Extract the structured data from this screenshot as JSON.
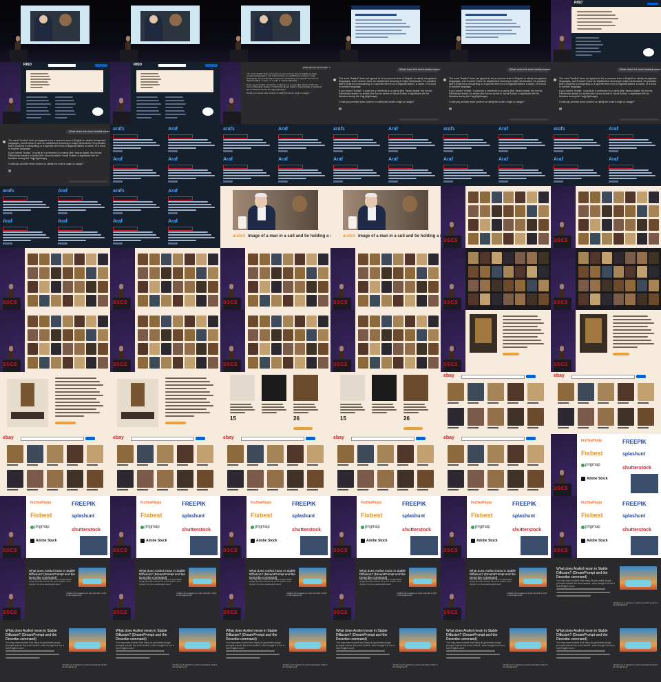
{
  "title": "",
  "grid": {
    "columns": 6,
    "rows": 11
  },
  "colors": {
    "stage_bg": "#07070c",
    "stage_floor": "#151322",
    "purple_bg": "#2a1c45",
    "cream": "#f6ebdd",
    "dark_chat": "#2b2b2d",
    "dark_navy": "#16202d",
    "ebay_blue": "#0064d2",
    "logo_red": "#d2202e",
    "highlight_orange": "#e8a23a"
  },
  "texts": {
    "site_brand": "RISD",
    "question": "What does the word arafed mean?",
    "answer_p1": "The word \"Arafed\" does not appear to be a common term in English or widely recognized languages, and it doesn't have an established meaning in major dictionaries. It's possible that it could be a misspelling or a specific term from a regional dialect, a name, or a word in another language.",
    "answer_p2": "If you meant \"Arafat,\" it could be a reference to a name (like Yasser Arafat, the former Palestinian leader) or Arafat (like Mount Arafat in Saudi Arabia, a significant site for Muslims during the Hajj pilgrimage).",
    "answer_p3": "Could you provide more context or clarify the word's origin or usage?",
    "footer_small": "ChatGPT can make mistakes. Check important info.",
    "dict_arafs": "arafs",
    "dict_araf": "Araf",
    "caption_word": "arafed",
    "caption_rest": " image of a man in a suit and tie holding a mirror",
    "product_price_1": "15",
    "product_price_2": "26",
    "ebay": "ebay",
    "sscs_logo": "SSCS",
    "logo_fixthephoto": "FixThePhoto",
    "logo_freepik": "FREEPIK",
    "logo_fixbest": "Fixbest",
    "logo_splashunt": "splashunt",
    "logo_pngmap": "pngmap",
    "logo_shutterstock": "shutterstock",
    "logo_adobe": "Adobe Stock",
    "post_title": "What does Arafed mean in Stable Diffusion? (DreamPrompt and the Describe command)",
    "post_body": "You may have noticed that many AI-generated image prompts include the word 'arafed', even though it is not a real English word.",
    "post_caption": "\"Arafed car is parked on a dirt road with a truck in the background\""
  },
  "cells": [
    {
      "type": "stage_tv",
      "theme": "dark"
    },
    {
      "type": "stage_tv",
      "theme": "dark"
    },
    {
      "type": "stage_tv",
      "theme": "dark"
    },
    {
      "type": "stage_web",
      "theme": "dark"
    },
    {
      "type": "stage_web",
      "theme": "dark"
    },
    {
      "type": "stage_web_spk",
      "theme": "dark"
    },
    {
      "type": "web_spk",
      "theme": "dark"
    },
    {
      "type": "web_spk",
      "theme": "dark"
    },
    {
      "type": "chat_spk",
      "theme": "dark"
    },
    {
      "type": "chat",
      "theme": "dark"
    },
    {
      "type": "chat",
      "theme": "dark"
    },
    {
      "type": "chat",
      "theme": "dark"
    },
    {
      "type": "chat",
      "theme": "dark"
    },
    {
      "type": "dict",
      "theme": "dark"
    },
    {
      "type": "dict",
      "theme": "dark"
    },
    {
      "type": "dict",
      "theme": "dark"
    },
    {
      "type": "dict",
      "theme": "dark"
    },
    {
      "type": "dict",
      "theme": "dark"
    },
    {
      "type": "dict",
      "theme": "dark"
    },
    {
      "type": "dict",
      "theme": "dark"
    },
    {
      "type": "photo_caption",
      "theme": "light"
    },
    {
      "type": "photo_caption",
      "theme": "light"
    },
    {
      "type": "gallery_spk",
      "theme": "dark"
    },
    {
      "type": "gallery_spk",
      "theme": "dark"
    },
    {
      "type": "gallery_spk",
      "theme": "dark"
    },
    {
      "type": "gallery_spk",
      "theme": "dark"
    },
    {
      "type": "gallery_spk",
      "theme": "dark"
    },
    {
      "type": "gallery_spk",
      "theme": "dark"
    },
    {
      "type": "gallery_dark_spk",
      "theme": "dark"
    },
    {
      "type": "gallery_dark_spk",
      "theme": "dark"
    },
    {
      "type": "gallery_spk",
      "theme": "dark"
    },
    {
      "type": "gallery_spk",
      "theme": "dark"
    },
    {
      "type": "gallery_spk",
      "theme": "dark"
    },
    {
      "type": "gallery_spk",
      "theme": "dark"
    },
    {
      "type": "product_spk",
      "theme": "dark"
    },
    {
      "type": "product_spk",
      "theme": "dark"
    },
    {
      "type": "product",
      "theme": "light"
    },
    {
      "type": "product",
      "theme": "light"
    },
    {
      "type": "products3",
      "theme": "light"
    },
    {
      "type": "products3",
      "theme": "light"
    },
    {
      "type": "ebay",
      "theme": "light"
    },
    {
      "type": "ebay",
      "theme": "light"
    },
    {
      "type": "ebay",
      "theme": "light"
    },
    {
      "type": "ebay",
      "theme": "light"
    },
    {
      "type": "ebay",
      "theme": "light"
    },
    {
      "type": "ebay",
      "theme": "light"
    },
    {
      "type": "ebay",
      "theme": "light"
    },
    {
      "type": "logos_spk",
      "theme": "dark"
    },
    {
      "type": "logos_spk",
      "theme": "dark"
    },
    {
      "type": "logos_spk",
      "theme": "dark"
    },
    {
      "type": "logos_spk",
      "theme": "dark"
    },
    {
      "type": "logos_spk",
      "theme": "dark"
    },
    {
      "type": "logos_spk",
      "theme": "dark"
    },
    {
      "type": "logos_spk",
      "theme": "dark"
    },
    {
      "type": "post_spk",
      "theme": "dark"
    },
    {
      "type": "post_spk",
      "theme": "dark"
    },
    {
      "type": "post_spk",
      "theme": "dark"
    },
    {
      "type": "post_spk",
      "theme": "dark"
    },
    {
      "type": "post_spk",
      "theme": "dark"
    },
    {
      "type": "post",
      "theme": "dark"
    },
    {
      "type": "post",
      "theme": "dark"
    },
    {
      "type": "post",
      "theme": "dark"
    },
    {
      "type": "post",
      "theme": "dark"
    },
    {
      "type": "post",
      "theme": "dark"
    },
    {
      "type": "post",
      "theme": "dark"
    },
    {
      "type": "post",
      "theme": "dark"
    }
  ]
}
